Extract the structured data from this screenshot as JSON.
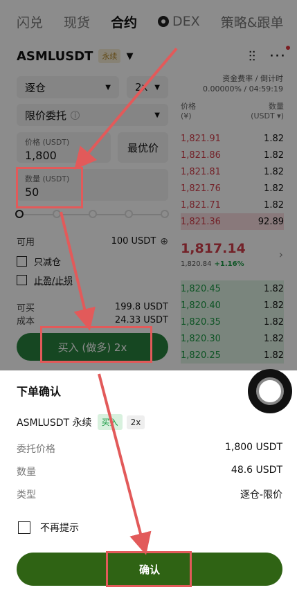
{
  "nav": {
    "tabs": [
      "闪兑",
      "现货",
      "合约",
      "DEX",
      "策略&跟单"
    ],
    "active_index": 2
  },
  "symbol": {
    "name": "ASMLUSDT",
    "perp_tag": "永续"
  },
  "funding": {
    "label": "资金费率 / 倒计时",
    "value": "0.00000% / 04:59:19"
  },
  "form": {
    "margin_mode": "逐仓",
    "leverage": "2x",
    "order_type": "限价委托",
    "price_label": "价格 (USDT)",
    "price_value": "1,800",
    "best_price_label": "最优价",
    "qty_label": "数量 (USDT)",
    "qty_value": "50",
    "available_label": "可用",
    "available_value": "100 USDT",
    "reduce_only_label": "只减仓",
    "tpsl_label": "止盈/止损",
    "can_buy_label": "可买",
    "can_buy_value": "199.8 USDT",
    "cost_label": "成本",
    "cost_value": "24.33 USDT",
    "buy_button_label": "买入 (做多) 2x"
  },
  "orderbook": {
    "price_header": "价格",
    "price_unit": "(¥)",
    "qty_header": "数量",
    "qty_unit": "(USDT ▾)",
    "asks": [
      {
        "price": "1,821.91",
        "amount": "1.82"
      },
      {
        "price": "1,821.86",
        "amount": "1.82"
      },
      {
        "price": "1,821.81",
        "amount": "1.82"
      },
      {
        "price": "1,821.76",
        "amount": "1.82"
      },
      {
        "price": "1,821.71",
        "amount": "1.82"
      },
      {
        "price": "1,821.36",
        "amount": "92.89"
      }
    ],
    "mid_price": "1,817.14",
    "mark_price": "1,820.84",
    "change": "+1.16%",
    "bids": [
      {
        "price": "1,820.45",
        "amount": "1.82"
      },
      {
        "price": "1,820.40",
        "amount": "1.82"
      },
      {
        "price": "1,820.35",
        "amount": "1.82"
      },
      {
        "price": "1,820.30",
        "amount": "1.82"
      },
      {
        "price": "1,820.25",
        "amount": "1.82"
      }
    ]
  },
  "confirm": {
    "title": "下单确认",
    "symbol": "ASMLUSDT 永续",
    "side_tag": "买入",
    "lev_tag": "2x",
    "rows": [
      {
        "key": "委托价格",
        "value": "1,800 USDT"
      },
      {
        "key": "数量",
        "value": "48.6 USDT"
      },
      {
        "key": "类型",
        "value": "逐仓-限价"
      }
    ],
    "dont_show_label": "不再提示",
    "confirm_label": "确认"
  },
  "colors": {
    "ask": "#d23f4b",
    "bid": "#1b9a44",
    "confirm": "#2f6314",
    "highlight": "#e25a5a"
  }
}
